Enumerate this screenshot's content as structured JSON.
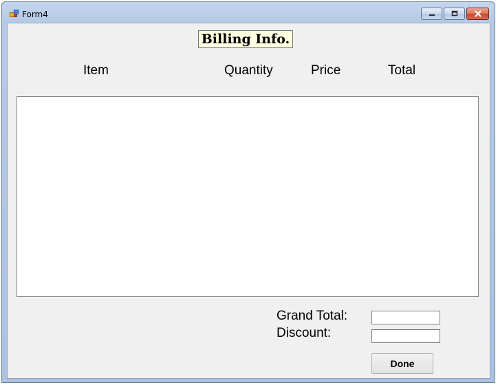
{
  "window": {
    "title": "Form4"
  },
  "form": {
    "heading": "Billing Info.",
    "columns": [
      "Item",
      "Quantity",
      "Price",
      "Total"
    ],
    "grand_total_label": "Grand Total:",
    "grand_total_value": "",
    "discount_label": "Discount:",
    "discount_value": "",
    "done_label": "Done"
  },
  "colors": {
    "titlebar": "#b9cde8",
    "client_background": "#f0f0f0",
    "heading_background": "#ffffe1",
    "close_button": "#c64830"
  },
  "icons": [
    "app-icon",
    "minimize-icon",
    "maximize-icon",
    "close-icon"
  ]
}
